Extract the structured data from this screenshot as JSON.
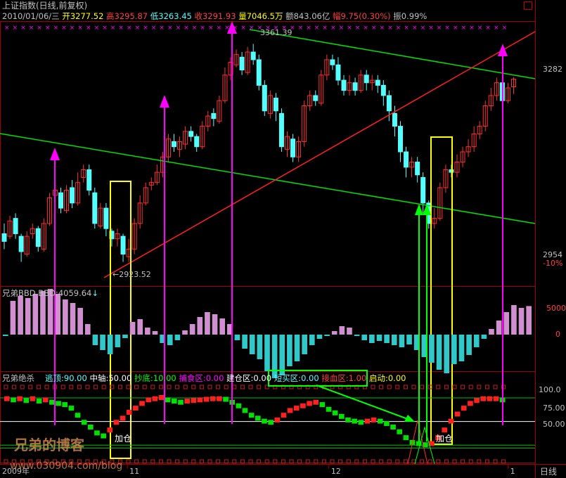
{
  "header": {
    "title": "上证指数(日线,前复权)",
    "date": "2010/01/06/三",
    "open_label": "开",
    "open": "3277.52",
    "high_label": "高",
    "high": "3295.87",
    "low_label": "低",
    "low": "3263.45",
    "close_label": "收",
    "close": "3291.93",
    "vol_label": "量",
    "vol": "7046.5万",
    "amt_label": "额",
    "amt": "843.06亿",
    "chg_label": "幅",
    "chg": "9.75(0.30%)",
    "amp_label": "振",
    "amp": "0.99%"
  },
  "colors": {
    "up": "#ff3030",
    "down": "#54ffff",
    "ma_green": "#00e000",
    "trend_red": "#ff2020",
    "magenta": "#ff00ff",
    "yellow": "#ffff00",
    "bbd_pink": "#d090d0",
    "bbd_cyan": "#30c8c8",
    "green_box": "#00ff00"
  },
  "main_chart": {
    "type": "candlestick",
    "ylim": [
      2900,
      3400
    ],
    "y_ticks": [
      "3282",
      "2954",
      "-10%"
    ],
    "annotations": {
      "high": "3361.39",
      "low": "←2923.52"
    },
    "candles": [
      [
        2990,
        2975,
        3010,
        2960
      ],
      [
        2985,
        3015,
        3025,
        2980
      ],
      [
        3020,
        2990,
        3030,
        2980
      ],
      [
        2985,
        2955,
        2990,
        2935
      ],
      [
        2950,
        2985,
        2995,
        2945
      ],
      [
        2990,
        3000,
        3010,
        2980
      ],
      [
        3000,
        2965,
        3005,
        2955
      ],
      [
        2960,
        3010,
        3020,
        2955
      ],
      [
        3010,
        3060,
        3070,
        3005
      ],
      [
        3065,
        3075,
        3085,
        3055
      ],
      [
        3070,
        3040,
        3080,
        3030
      ],
      [
        3035,
        3075,
        3085,
        3030
      ],
      [
        3080,
        3050,
        3095,
        3040
      ],
      [
        3050,
        3090,
        3110,
        3045
      ],
      [
        3100,
        3115,
        3125,
        3090
      ],
      [
        3115,
        3075,
        3125,
        3065
      ],
      [
        3070,
        3010,
        3080,
        3000
      ],
      [
        3005,
        3040,
        3050,
        3000
      ],
      [
        3040,
        3000,
        3050,
        2985
      ],
      [
        2995,
        2980,
        3000,
        2965
      ],
      [
        2980,
        2990,
        3000,
        2965
      ],
      [
        2985,
        2950,
        2990,
        2935
      ],
      [
        2945,
        2960,
        2980,
        2935
      ],
      [
        2960,
        3010,
        3020,
        2950
      ],
      [
        3010,
        3050,
        3065,
        3000
      ],
      [
        3050,
        3080,
        3090,
        3045
      ],
      [
        3085,
        3090,
        3100,
        3075
      ],
      [
        3090,
        3110,
        3125,
        3085
      ],
      [
        3110,
        3140,
        3150,
        3100
      ],
      [
        3140,
        3175,
        3185,
        3130
      ],
      [
        3170,
        3160,
        3185,
        3150
      ],
      [
        3155,
        3170,
        3180,
        3140
      ],
      [
        3165,
        3190,
        3200,
        3155
      ],
      [
        3190,
        3180,
        3200,
        3170
      ],
      [
        3180,
        3160,
        3185,
        3150
      ],
      [
        3160,
        3200,
        3210,
        3155
      ],
      [
        3200,
        3220,
        3230,
        3190
      ],
      [
        3225,
        3215,
        3235,
        3200
      ],
      [
        3210,
        3250,
        3260,
        3205
      ],
      [
        3250,
        3300,
        3315,
        3245
      ],
      [
        3300,
        3325,
        3335,
        3290
      ],
      [
        3320,
        3340,
        3350,
        3315
      ],
      [
        3335,
        3310,
        3345,
        3300
      ],
      [
        3305,
        3345,
        3355,
        3300
      ],
      [
        3345,
        3330,
        3361,
        3320
      ],
      [
        3330,
        3280,
        3340,
        3270
      ],
      [
        3280,
        3230,
        3290,
        3220
      ],
      [
        3225,
        3260,
        3270,
        3215
      ],
      [
        3255,
        3230,
        3265,
        3210
      ],
      [
        3225,
        3160,
        3235,
        3150
      ],
      [
        3155,
        3180,
        3190,
        3140
      ],
      [
        3175,
        3140,
        3185,
        3130
      ],
      [
        3140,
        3170,
        3180,
        3130
      ],
      [
        3170,
        3240,
        3250,
        3160
      ],
      [
        3240,
        3260,
        3270,
        3230
      ],
      [
        3260,
        3250,
        3270,
        3240
      ],
      [
        3245,
        3300,
        3310,
        3240
      ],
      [
        3300,
        3330,
        3340,
        3290
      ],
      [
        3330,
        3320,
        3340,
        3310
      ],
      [
        3320,
        3290,
        3335,
        3280
      ],
      [
        3290,
        3270,
        3300,
        3260
      ],
      [
        3270,
        3285,
        3300,
        3260
      ],
      [
        3285,
        3270,
        3295,
        3260
      ],
      [
        3270,
        3300,
        3310,
        3265
      ],
      [
        3300,
        3285,
        3310,
        3270
      ],
      [
        3285,
        3290,
        3300,
        3270
      ],
      [
        3290,
        3280,
        3300,
        3265
      ],
      [
        3280,
        3260,
        3290,
        3240
      ],
      [
        3260,
        3230,
        3270,
        3210
      ],
      [
        3225,
        3200,
        3240,
        3180
      ],
      [
        3200,
        3150,
        3210,
        3130
      ],
      [
        3150,
        3120,
        3160,
        3100
      ],
      [
        3120,
        3130,
        3140,
        3100
      ],
      [
        3130,
        3105,
        3140,
        3090
      ],
      [
        3100,
        3050,
        3110,
        3030
      ],
      [
        3050,
        3010,
        3055,
        3000
      ],
      [
        3010,
        3020,
        3040,
        3000
      ],
      [
        3020,
        3080,
        3090,
        3015
      ],
      [
        3080,
        3115,
        3125,
        3070
      ],
      [
        3115,
        3110,
        3125,
        3100
      ],
      [
        3110,
        3130,
        3145,
        3100
      ],
      [
        3130,
        3150,
        3160,
        3120
      ],
      [
        3150,
        3160,
        3175,
        3140
      ],
      [
        3160,
        3185,
        3200,
        3150
      ],
      [
        3185,
        3200,
        3210,
        3175
      ],
      [
        3200,
        3240,
        3250,
        3190
      ],
      [
        3240,
        3260,
        3275,
        3230
      ],
      [
        3260,
        3285,
        3295,
        3250
      ],
      [
        3285,
        3250,
        3295,
        3240
      ],
      [
        3250,
        3275,
        3285,
        3245
      ],
      [
        3277,
        3292,
        3296,
        3263
      ]
    ]
  },
  "bbd": {
    "title": "兄弟BBD",
    "label": "BBD:",
    "value": "4059.64",
    "ylim": [
      -6500,
      7000
    ],
    "y_ticks": [
      "5000",
      "0"
    ],
    "bars": [
      -200,
      4800,
      5500,
      5200,
      5800,
      6200,
      6500,
      5800,
      5000,
      4500,
      3800,
      1500,
      -1500,
      -2200,
      -2800,
      -1800,
      -500,
      1800,
      2200,
      1000,
      500,
      -1200,
      -1500,
      -800,
      600,
      1500,
      2500,
      3200,
      2900,
      2300,
      1500,
      -800,
      -2000,
      -2800,
      -3500,
      -5200,
      -6200,
      -5800,
      -4500,
      -3800,
      -2800,
      -1500,
      -600,
      -200,
      500,
      1200,
      1000,
      -200,
      -800,
      -1200,
      -900,
      -1200,
      -1500,
      -1800,
      -1400,
      -2200,
      -3200,
      -4000,
      -5000,
      -5500,
      -4200,
      -3800,
      -2900,
      -1800,
      -600,
      800,
      2000,
      3200,
      4200,
      3800,
      4059
    ]
  },
  "indicator": {
    "title": "兄弟绝杀",
    "ylim": [
      -10,
      115
    ],
    "y_ticks": [
      "100.0",
      "75.00",
      "50.00"
    ],
    "params": [
      {
        "label": "逃顶:",
        "value": "90.00"
      },
      {
        "label": "中轴:",
        "value": "50.00"
      },
      {
        "label": "抄底:",
        "value": "10.00"
      },
      {
        "label": "捕食区:",
        "value": "0.00"
      },
      {
        "label": "建仓区:",
        "value": "0.00"
      },
      {
        "label": "短买区:",
        "value": "0.00"
      },
      {
        "label": "接血区:",
        "value": "1.00"
      },
      {
        "label": "启动:",
        "value": "0.00"
      }
    ],
    "annotation": "加仓",
    "values": [
      88,
      86,
      88,
      85,
      88,
      84,
      86,
      82,
      80,
      78,
      72,
      60,
      48,
      40,
      30,
      25,
      35,
      48,
      55,
      65,
      72,
      80,
      86,
      88,
      90,
      86,
      84,
      82,
      84,
      85,
      86,
      87,
      88,
      88,
      87,
      82,
      76,
      68,
      60,
      55,
      50,
      48,
      52,
      60,
      68,
      72,
      76,
      80,
      82,
      78,
      70,
      64,
      58,
      52,
      50,
      48,
      50,
      52,
      50,
      46,
      40,
      32,
      22,
      14,
      12,
      10,
      12,
      22,
      35,
      50,
      62,
      72,
      80,
      85,
      88,
      88,
      88,
      86
    ],
    "buy_arrows_idx": [
      70,
      72
    ]
  },
  "time_axis": {
    "year": "2009年",
    "ticks": [
      {
        "i": 22,
        "label": "11"
      },
      {
        "i": 58,
        "label": "12"
      },
      {
        "i": 90,
        "label": "1"
      }
    ],
    "period": "日线"
  },
  "watermark": {
    "line1": "兄弟的博客",
    "line2": "www.030904.com/blog"
  }
}
